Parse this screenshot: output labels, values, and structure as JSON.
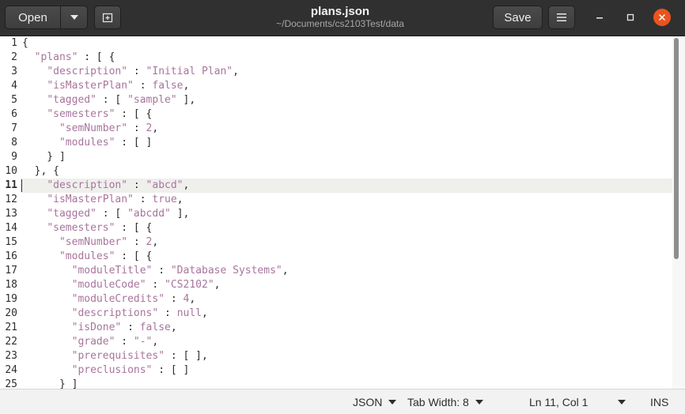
{
  "header": {
    "open_label": "Open",
    "save_label": "Save",
    "title": "plans.json",
    "subtitle": "~/Documents/cs2103Test/data"
  },
  "editor": {
    "current_line_number": 11,
    "line_numbers": [
      "1",
      "2",
      "3",
      "4",
      "5",
      "6",
      "7",
      "8",
      "9",
      "10",
      "11",
      "12",
      "13",
      "14",
      "15",
      "16",
      "17",
      "18",
      "19",
      "20",
      "21",
      "22",
      "23",
      "24",
      "25"
    ],
    "lines": [
      [
        {
          "c": "p",
          "t": "{"
        }
      ],
      [
        {
          "c": "p",
          "t": "  "
        },
        {
          "c": "k",
          "t": "\"plans\""
        },
        {
          "c": "p",
          "t": " : [ {"
        }
      ],
      [
        {
          "c": "p",
          "t": "    "
        },
        {
          "c": "k",
          "t": "\"description\""
        },
        {
          "c": "p",
          "t": " : "
        },
        {
          "c": "k",
          "t": "\"Initial Plan\""
        },
        {
          "c": "p",
          "t": ","
        }
      ],
      [
        {
          "c": "p",
          "t": "    "
        },
        {
          "c": "k",
          "t": "\"isMasterPlan\""
        },
        {
          "c": "p",
          "t": " : "
        },
        {
          "c": "k",
          "t": "false"
        },
        {
          "c": "p",
          "t": ","
        }
      ],
      [
        {
          "c": "p",
          "t": "    "
        },
        {
          "c": "k",
          "t": "\"tagged\""
        },
        {
          "c": "p",
          "t": " : [ "
        },
        {
          "c": "k",
          "t": "\"sample\""
        },
        {
          "c": "p",
          "t": " ],"
        }
      ],
      [
        {
          "c": "p",
          "t": "    "
        },
        {
          "c": "k",
          "t": "\"semesters\""
        },
        {
          "c": "p",
          "t": " : [ {"
        }
      ],
      [
        {
          "c": "p",
          "t": "      "
        },
        {
          "c": "k",
          "t": "\"semNumber\""
        },
        {
          "c": "p",
          "t": " : "
        },
        {
          "c": "k",
          "t": "2"
        },
        {
          "c": "p",
          "t": ","
        }
      ],
      [
        {
          "c": "p",
          "t": "      "
        },
        {
          "c": "k",
          "t": "\"modules\""
        },
        {
          "c": "p",
          "t": " : [ ]"
        }
      ],
      [
        {
          "c": "p",
          "t": "    } ]"
        }
      ],
      [
        {
          "c": "p",
          "t": "  }, {"
        }
      ],
      [
        {
          "c": "p",
          "t": "    "
        },
        {
          "c": "k",
          "t": "\"description\""
        },
        {
          "c": "p",
          "t": " : "
        },
        {
          "c": "k",
          "t": "\"abcd\""
        },
        {
          "c": "p",
          "t": ","
        }
      ],
      [
        {
          "c": "p",
          "t": "    "
        },
        {
          "c": "k",
          "t": "\"isMasterPlan\""
        },
        {
          "c": "p",
          "t": " : "
        },
        {
          "c": "k",
          "t": "true"
        },
        {
          "c": "p",
          "t": ","
        }
      ],
      [
        {
          "c": "p",
          "t": "    "
        },
        {
          "c": "k",
          "t": "\"tagged\""
        },
        {
          "c": "p",
          "t": " : [ "
        },
        {
          "c": "k",
          "t": "\"abcdd\""
        },
        {
          "c": "p",
          "t": " ],"
        }
      ],
      [
        {
          "c": "p",
          "t": "    "
        },
        {
          "c": "k",
          "t": "\"semesters\""
        },
        {
          "c": "p",
          "t": " : [ {"
        }
      ],
      [
        {
          "c": "p",
          "t": "      "
        },
        {
          "c": "k",
          "t": "\"semNumber\""
        },
        {
          "c": "p",
          "t": " : "
        },
        {
          "c": "k",
          "t": "2"
        },
        {
          "c": "p",
          "t": ","
        }
      ],
      [
        {
          "c": "p",
          "t": "      "
        },
        {
          "c": "k",
          "t": "\"modules\""
        },
        {
          "c": "p",
          "t": " : [ {"
        }
      ],
      [
        {
          "c": "p",
          "t": "        "
        },
        {
          "c": "k",
          "t": "\"moduleTitle\""
        },
        {
          "c": "p",
          "t": " : "
        },
        {
          "c": "k",
          "t": "\"Database Systems\""
        },
        {
          "c": "p",
          "t": ","
        }
      ],
      [
        {
          "c": "p",
          "t": "        "
        },
        {
          "c": "k",
          "t": "\"moduleCode\""
        },
        {
          "c": "p",
          "t": " : "
        },
        {
          "c": "k",
          "t": "\"CS2102\""
        },
        {
          "c": "p",
          "t": ","
        }
      ],
      [
        {
          "c": "p",
          "t": "        "
        },
        {
          "c": "k",
          "t": "\"moduleCredits\""
        },
        {
          "c": "p",
          "t": " : "
        },
        {
          "c": "k",
          "t": "4"
        },
        {
          "c": "p",
          "t": ","
        }
      ],
      [
        {
          "c": "p",
          "t": "        "
        },
        {
          "c": "k",
          "t": "\"descriptions\""
        },
        {
          "c": "p",
          "t": " : "
        },
        {
          "c": "k",
          "t": "null"
        },
        {
          "c": "p",
          "t": ","
        }
      ],
      [
        {
          "c": "p",
          "t": "        "
        },
        {
          "c": "k",
          "t": "\"isDone\""
        },
        {
          "c": "p",
          "t": " : "
        },
        {
          "c": "k",
          "t": "false"
        },
        {
          "c": "p",
          "t": ","
        }
      ],
      [
        {
          "c": "p",
          "t": "        "
        },
        {
          "c": "k",
          "t": "\"grade\""
        },
        {
          "c": "p",
          "t": " : "
        },
        {
          "c": "k",
          "t": "\"-\""
        },
        {
          "c": "p",
          "t": ","
        }
      ],
      [
        {
          "c": "p",
          "t": "        "
        },
        {
          "c": "k",
          "t": "\"prerequisites\""
        },
        {
          "c": "p",
          "t": " : [ ],"
        }
      ],
      [
        {
          "c": "p",
          "t": "        "
        },
        {
          "c": "k",
          "t": "\"preclusions\""
        },
        {
          "c": "p",
          "t": " : [ ]"
        }
      ],
      [
        {
          "c": "p",
          "t": "      } ]"
        }
      ]
    ]
  },
  "statusbar": {
    "language": "JSON",
    "tab_width": "Tab Width: 8",
    "position": "Ln 11, Col 1",
    "mode": "INS"
  },
  "colors": {
    "header_bg": "#303030",
    "syntax_purple": "#a8749c",
    "close_orange": "#e95420",
    "current_line_bg": "#efefec"
  }
}
